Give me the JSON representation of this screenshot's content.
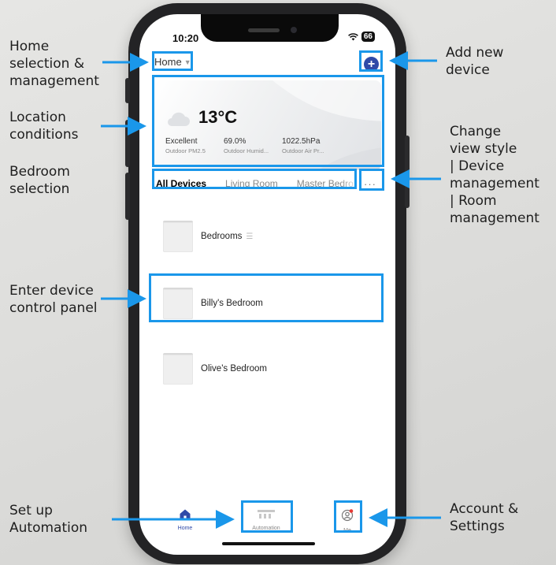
{
  "callouts": {
    "home_selection": "Home\nselection &\nmanagement",
    "location_conditions": "Location\nconditions",
    "bedroom_selection": "Bedroom\nselection",
    "enter_device_panel": "Enter device\ncontrol panel",
    "setup_automation": "Set up\nAutomation",
    "add_new_device": "Add new\ndevice",
    "change_view_style": "Change\nview style\n| Device\nmanagement\n| Room\nmanagement",
    "account_settings": "Account &\nSettings"
  },
  "status_bar": {
    "time": "10:20",
    "battery": "66"
  },
  "header": {
    "home_label": "Home",
    "add_label": "+"
  },
  "weather": {
    "temperature": "13°C",
    "stats": [
      {
        "value": "Excellent",
        "label": "Outdoor PM2.5"
      },
      {
        "value": "69.0%",
        "label": "Outdoor Humid..."
      },
      {
        "value": "1022.5hPa",
        "label": "Outdoor Air Pr..."
      }
    ]
  },
  "rooms": {
    "tabs": [
      "All Devices",
      "Living Room",
      "Master Bedro"
    ],
    "more_label": "···"
  },
  "devices": [
    {
      "name": "Bedrooms"
    },
    {
      "name": "Billy's Bedroom"
    },
    {
      "name": "Olive's Bedroom"
    }
  ],
  "tabbar": {
    "items": [
      "Home",
      "Automation",
      "Me"
    ]
  },
  "colors": {
    "highlight": "#1a97ea",
    "accent": "#2f4aa8",
    "phone_frame": "#232325"
  },
  "icons": {
    "callout_arrows": "arrow-icon",
    "weather": "cloud-icon",
    "add": "plus-circle-icon",
    "more": "more-dots-icon",
    "reorder": "drag-handle-icon",
    "tab_home": "home-icon",
    "tab_automation": "automation-icon",
    "tab_me": "user-icon"
  }
}
